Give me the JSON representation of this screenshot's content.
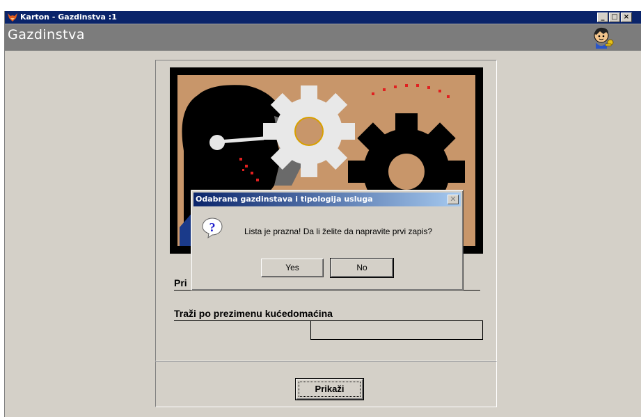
{
  "window": {
    "title": "Karton - Gazdinstva :1",
    "controls": {
      "minimize": "_",
      "maximize": "□",
      "close": "×"
    }
  },
  "header": {
    "title": "Gazdinstva"
  },
  "form": {
    "label_top": "Pri",
    "search_label": "Traži po prezimenu kućedomaćina",
    "search_value": "",
    "show_button": "Prikaži"
  },
  "dialog": {
    "title": "Odabrana gazdinstava i tipologija usluga",
    "message": "Lista je prazna!  Da li želite da napravite prvi zapis?",
    "yes_label": "Yes",
    "no_label": "No"
  },
  "colors": {
    "titlebar": "#0a246a",
    "window_bg": "#d4d0c8",
    "header_band": "#7c7c7c",
    "banner_bg": "#c8966a"
  }
}
